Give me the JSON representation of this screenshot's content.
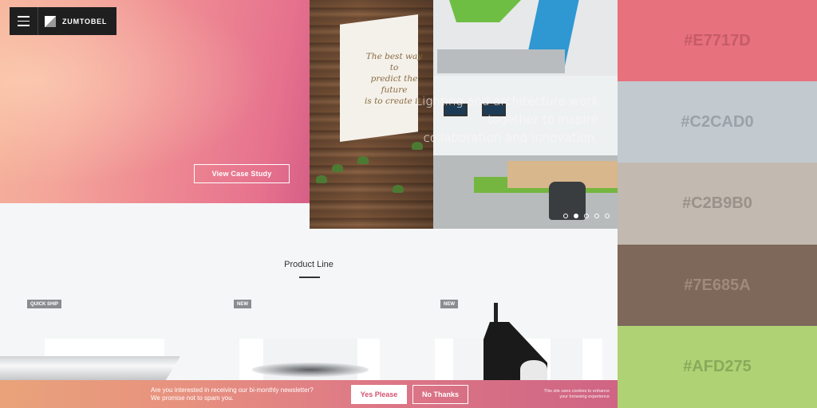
{
  "header": {
    "logo_text": "ZUMTOBEL"
  },
  "hero": {
    "headline_line1": "Lighting and architecture work",
    "headline_line2": "together to inspire",
    "headline_line3": "collaboration and innovation.",
    "cta_label": "View Case Study",
    "wall_quote_line1": "The best way to",
    "wall_quote_line2": "predict the future",
    "wall_quote_line3": "is to create it.",
    "carousel_active_index": 2,
    "carousel_count": 5
  },
  "products": {
    "section_title": "Product Line",
    "tags": [
      "QUICK SHIP",
      "NEW",
      "NEW"
    ]
  },
  "newsletter": {
    "line1": "Are you interested in receiving our bi-monthly newsletter?",
    "line2": "We promise not to spam you.",
    "yes_label": "Yes Please",
    "no_label": "No Thanks",
    "cookie_line1": "This site uses cookies to enhance",
    "cookie_line2": "your browsing experience"
  },
  "palette": {
    "swatches": [
      {
        "label": "#E7717D",
        "color": "#E7717D",
        "text_color": "#c45c67"
      },
      {
        "label": "#C2CAD0",
        "color": "#C2CAD0",
        "text_color": "#9aa2a8"
      },
      {
        "label": "#C2B9B0",
        "color": "#C2B9B0",
        "text_color": "#9a918a"
      },
      {
        "label": "#7E685A",
        "color": "#7E685A",
        "text_color": "#a08a7c"
      },
      {
        "label": "#AFD275",
        "color": "#AFD275",
        "text_color": "#8aa95b"
      }
    ]
  }
}
